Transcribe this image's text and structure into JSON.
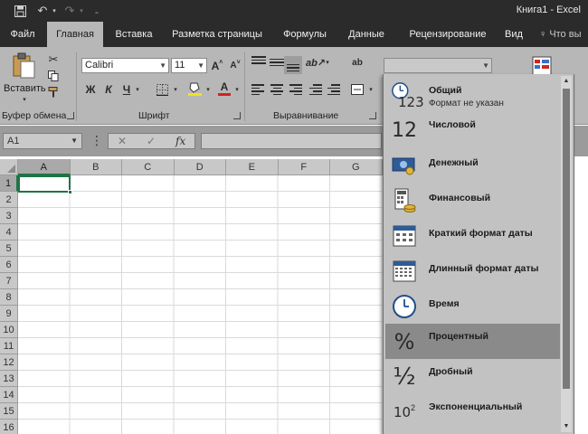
{
  "window": {
    "title": "Книга1  -  Excel"
  },
  "tabs": [
    "Файл",
    "Главная",
    "Вставка",
    "Разметка страницы",
    "Формулы",
    "Данные",
    "Рецензирование",
    "Вид"
  ],
  "active_tab": "Главная",
  "help": {
    "label": "Что вы"
  },
  "ribbon": {
    "paste_label": "Вставить",
    "groups": {
      "clipboard": "Буфер обмена",
      "font": "Шрифт",
      "alignment": "Выравнивание"
    },
    "font_name": "Calibri",
    "font_size": "11",
    "font_grow": "A",
    "font_shrink": "A",
    "bold": "Ж",
    "italic": "К",
    "underline": "Ч",
    "font_color_letter": "A"
  },
  "formula_bar": {
    "name_box": "A1",
    "fx": "fx",
    "cancel": "✕",
    "enter": "✓"
  },
  "grid": {
    "columns": [
      "A",
      "B",
      "C",
      "D",
      "E",
      "F",
      "G"
    ],
    "rows": [
      "1",
      "2",
      "3",
      "4",
      "5",
      "6",
      "7",
      "8",
      "9",
      "10",
      "11",
      "12",
      "13",
      "14",
      "15",
      "16"
    ],
    "selected_cell": "A1"
  },
  "number_formats": [
    {
      "label": "Общий",
      "sub": "Формат не указан",
      "icon": "clock-123-icon"
    },
    {
      "label": "Числовой",
      "icon": "number-12-icon"
    },
    {
      "label": "Денежный",
      "icon": "currency-icon"
    },
    {
      "label": "Финансовый",
      "icon": "accounting-icon"
    },
    {
      "label": "Краткий формат даты",
      "icon": "calendar-short-icon"
    },
    {
      "label": "Длинный формат даты",
      "icon": "calendar-long-icon"
    },
    {
      "label": "Время",
      "icon": "clock-icon"
    },
    {
      "label": "Процентный",
      "icon": "percent-icon",
      "highlighted": true
    },
    {
      "label": "Дробный",
      "icon": "fraction-icon"
    },
    {
      "label": "Экспоненциальный",
      "icon": "scientific-icon"
    }
  ],
  "icon_glyphs": {
    "twelve": "12",
    "one_two_three": "123",
    "percent": "%",
    "half": "½",
    "ten": "10",
    "exp": "2"
  },
  "colors": {
    "excel_green": "#217346",
    "highlight": "#8a8a8a",
    "ribbon": "#b7b7b7",
    "titlebar": "#2b2b2b"
  }
}
